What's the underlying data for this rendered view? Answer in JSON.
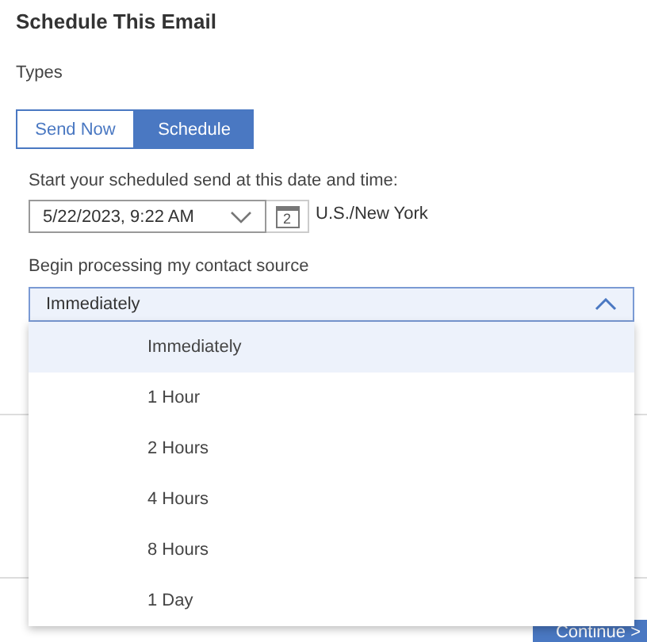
{
  "title": "Schedule This Email",
  "types_label": "Types",
  "tabs": [
    {
      "label": "Send Now",
      "selected": false
    },
    {
      "label": "Schedule",
      "selected": true
    }
  ],
  "date_label": "Start your scheduled send at this date and time:",
  "date_field": {
    "value": "5/22/2023, 9:22 AM"
  },
  "calendar_day": "2",
  "timezone": "U.S./New York",
  "processing_label": "Begin processing my contact source",
  "processing_select": {
    "value": "Immediately",
    "expanded": true
  },
  "options": [
    {
      "label": "Immediately",
      "selected": true
    },
    {
      "label": "1 Hour",
      "selected": false
    },
    {
      "label": "2 Hours",
      "selected": false
    },
    {
      "label": "4 Hours",
      "selected": false
    },
    {
      "label": "8 Hours",
      "selected": false
    },
    {
      "label": "1 Day",
      "selected": false
    }
  ],
  "continue_button": "Continue >"
}
